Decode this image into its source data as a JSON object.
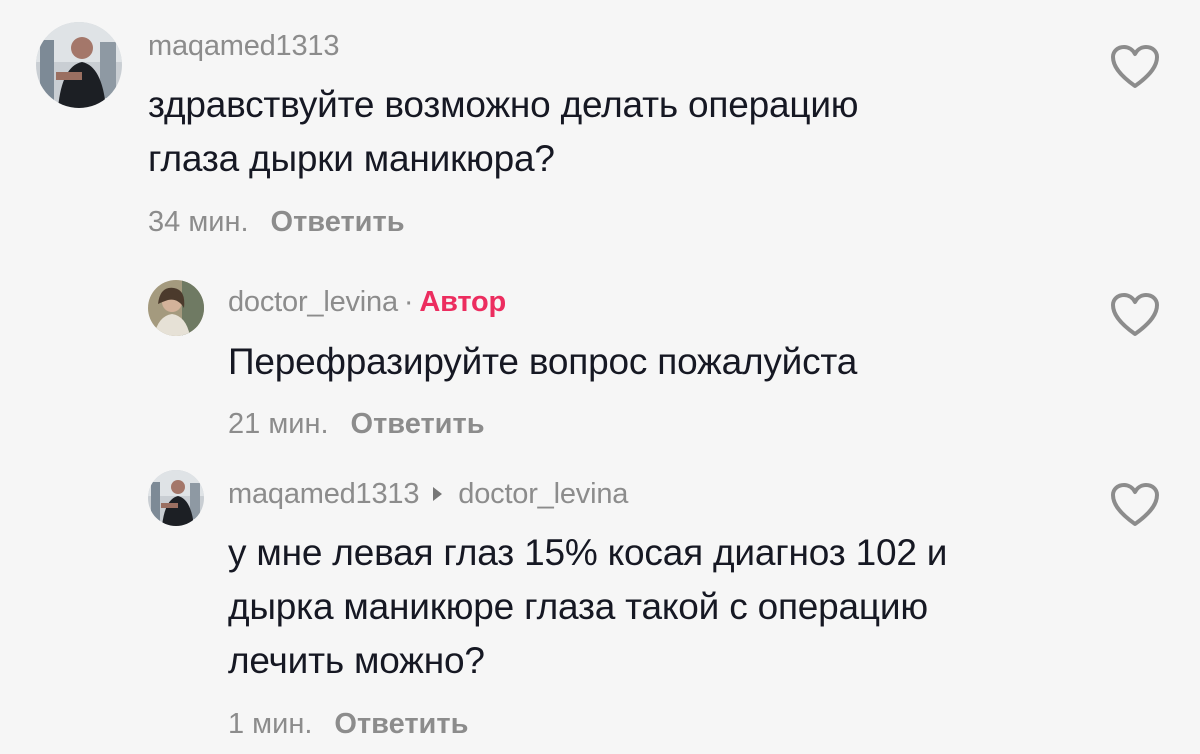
{
  "comments": [
    {
      "username": "maqamed1313",
      "text_lines": [
        "здравствуйте возможно делать операцию",
        "глаза дырки маникюра?"
      ],
      "time": "34 мин.",
      "reply_label": "Ответить",
      "like_icon": "heart-outline-icon"
    },
    {
      "username": "doctor_levina",
      "separator": "·",
      "badge": "Автор",
      "text_lines": [
        "Перефразируйте вопрос пожалуйста"
      ],
      "time": "21 мин.",
      "reply_label": "Ответить",
      "like_icon": "heart-outline-icon"
    },
    {
      "username": "maqamed1313",
      "reply_to": "doctor_levina",
      "text_lines": [
        "у мне левая глаз 15% косая диагноз 102 и",
        "дырка маникюре глаза такой с операцию",
        "лечить можно?"
      ],
      "time": "1 мин.",
      "reply_label": "Ответить",
      "like_icon": "heart-outline-icon"
    }
  ],
  "colors": {
    "background": "#f6f6f6",
    "text": "#161823",
    "muted": "#8c8c8c",
    "author_badge": "#ec2d5f"
  }
}
